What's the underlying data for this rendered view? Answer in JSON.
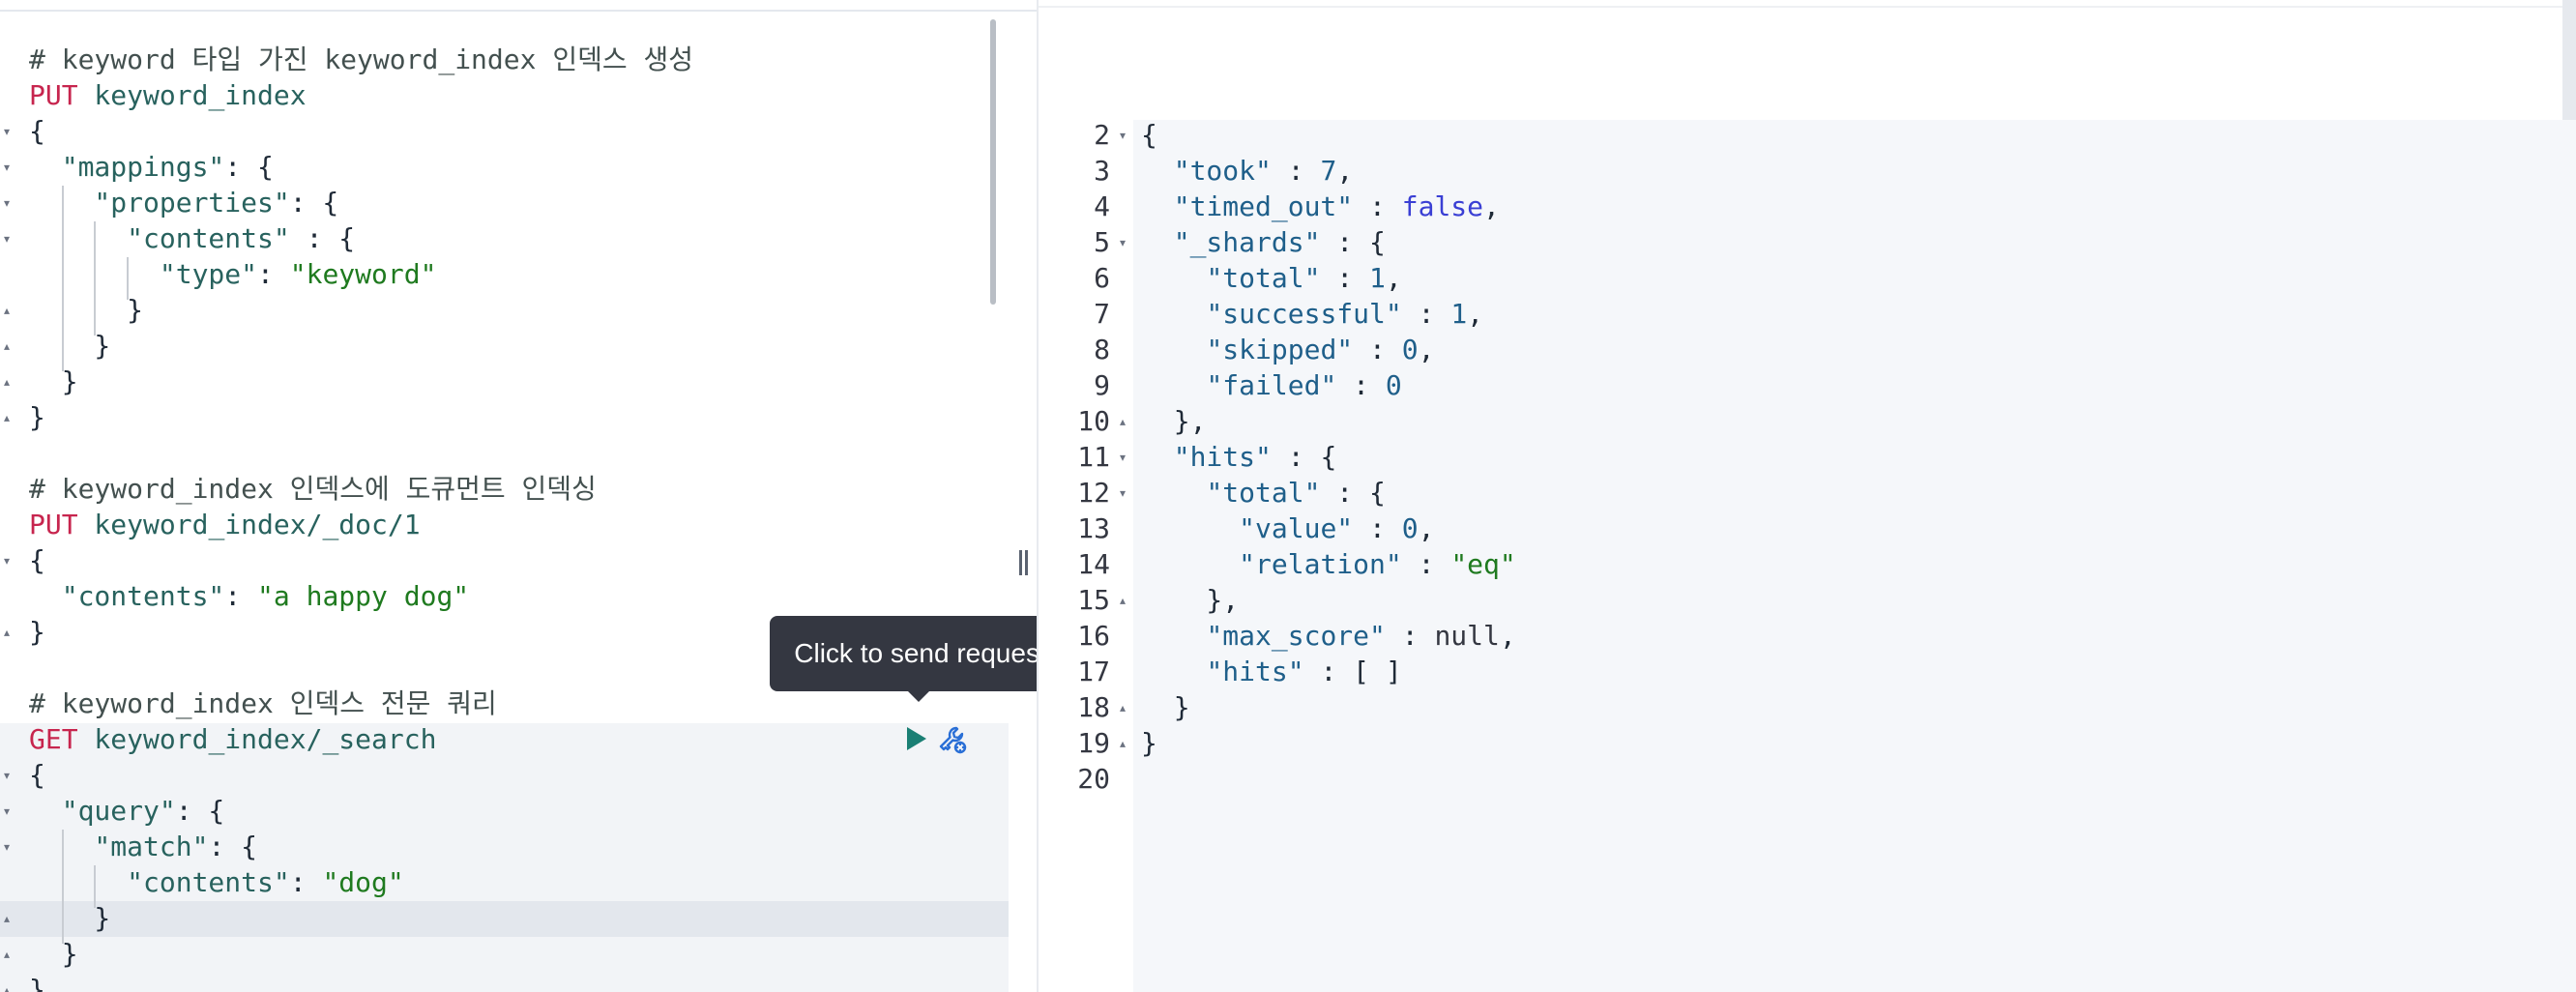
{
  "editor": {
    "lines": [
      {
        "text": "# keyword 타입 가진 keyword_index 인덱스 생성",
        "kind": "comment"
      },
      {
        "method": "PUT",
        "url": " keyword_index",
        "kind": "request"
      },
      {
        "text": "{",
        "kind": "punct"
      },
      {
        "key": "  \"mappings\"",
        "rest": ": {",
        "kind": "kv"
      },
      {
        "key": "    \"properties\"",
        "rest": ": {",
        "kind": "kv"
      },
      {
        "key": "      \"contents\"",
        "rest": " : {",
        "kind": "kv"
      },
      {
        "key": "        \"type\"",
        "rest": ": ",
        "str": "\"keyword\"",
        "kind": "kvs"
      },
      {
        "text": "      }",
        "kind": "punct"
      },
      {
        "text": "    }",
        "kind": "punct"
      },
      {
        "text": "  }",
        "kind": "punct"
      },
      {
        "text": "}",
        "kind": "punct"
      },
      {
        "text": "",
        "kind": "blank"
      },
      {
        "text": "# keyword_index 인덱스에 도큐먼트 인덱싱",
        "kind": "comment"
      },
      {
        "method": "PUT",
        "url": " keyword_index/_doc/1",
        "kind": "request"
      },
      {
        "text": "{",
        "kind": "punct"
      },
      {
        "key": "  \"contents\"",
        "rest": ": ",
        "str": "\"a happy dog\"",
        "kind": "kvs"
      },
      {
        "text": "}",
        "kind": "punct"
      },
      {
        "text": "",
        "kind": "blank"
      },
      {
        "text": "# keyword_index 인덱스 전문 쿼리",
        "kind": "comment"
      },
      {
        "method": "GET",
        "url": " keyword_index/_search",
        "kind": "request"
      },
      {
        "text": "{",
        "kind": "punct"
      },
      {
        "key": "  \"query\"",
        "rest": ": {",
        "kind": "kv"
      },
      {
        "key": "    \"match\"",
        "rest": ": {",
        "kind": "kv"
      },
      {
        "key": "      \"contents\"",
        "rest": ": ",
        "str": "\"dog\"",
        "kind": "kvs"
      },
      {
        "text": "    }",
        "kind": "punct"
      },
      {
        "text": "  }",
        "kind": "punct"
      },
      {
        "text": "}",
        "kind": "punct"
      }
    ]
  },
  "actions": {
    "send_icon": "play-icon",
    "settings_icon": "wrench-icon",
    "tooltip": "Click to send request"
  },
  "response": {
    "lines": [
      {
        "num": "2",
        "parts": [
          [
            "p",
            "{"
          ]
        ]
      },
      {
        "num": "3",
        "parts": [
          [
            "p",
            "  "
          ],
          [
            "k",
            "\"took\""
          ],
          [
            "p",
            " : "
          ],
          [
            "n",
            "7"
          ],
          [
            "p",
            ","
          ]
        ]
      },
      {
        "num": "4",
        "parts": [
          [
            "p",
            "  "
          ],
          [
            "k",
            "\"timed_out\""
          ],
          [
            "p",
            " : "
          ],
          [
            "b",
            "false"
          ],
          [
            "p",
            ","
          ]
        ]
      },
      {
        "num": "5",
        "parts": [
          [
            "p",
            "  "
          ],
          [
            "k",
            "\"_shards\""
          ],
          [
            "p",
            " : {"
          ]
        ]
      },
      {
        "num": "6",
        "parts": [
          [
            "p",
            "    "
          ],
          [
            "k",
            "\"total\""
          ],
          [
            "p",
            " : "
          ],
          [
            "n",
            "1"
          ],
          [
            "p",
            ","
          ]
        ]
      },
      {
        "num": "7",
        "parts": [
          [
            "p",
            "    "
          ],
          [
            "k",
            "\"successful\""
          ],
          [
            "p",
            " : "
          ],
          [
            "n",
            "1"
          ],
          [
            "p",
            ","
          ]
        ]
      },
      {
        "num": "8",
        "parts": [
          [
            "p",
            "    "
          ],
          [
            "k",
            "\"skipped\""
          ],
          [
            "p",
            " : "
          ],
          [
            "n",
            "0"
          ],
          [
            "p",
            ","
          ]
        ]
      },
      {
        "num": "9",
        "parts": [
          [
            "p",
            "    "
          ],
          [
            "k",
            "\"failed\""
          ],
          [
            "p",
            " : "
          ],
          [
            "n",
            "0"
          ]
        ]
      },
      {
        "num": "10",
        "parts": [
          [
            "p",
            "  },"
          ]
        ]
      },
      {
        "num": "11",
        "parts": [
          [
            "p",
            "  "
          ],
          [
            "k",
            "\"hits\""
          ],
          [
            "p",
            " : {"
          ]
        ]
      },
      {
        "num": "12",
        "parts": [
          [
            "p",
            "    "
          ],
          [
            "k",
            "\"total\""
          ],
          [
            "p",
            " : {"
          ]
        ]
      },
      {
        "num": "13",
        "parts": [
          [
            "p",
            "      "
          ],
          [
            "k",
            "\"value\""
          ],
          [
            "p",
            " : "
          ],
          [
            "n",
            "0"
          ],
          [
            "p",
            ","
          ]
        ]
      },
      {
        "num": "14",
        "parts": [
          [
            "p",
            "      "
          ],
          [
            "k",
            "\"relation\""
          ],
          [
            "p",
            " : "
          ],
          [
            "s",
            "\"eq\""
          ]
        ]
      },
      {
        "num": "15",
        "parts": [
          [
            "p",
            "    },"
          ]
        ]
      },
      {
        "num": "16",
        "parts": [
          [
            "p",
            "    "
          ],
          [
            "k",
            "\"max_score\""
          ],
          [
            "p",
            " : "
          ],
          [
            "x",
            "null"
          ],
          [
            "p",
            ","
          ]
        ]
      },
      {
        "num": "17",
        "parts": [
          [
            "p",
            "    "
          ],
          [
            "k",
            "\"hits\""
          ],
          [
            "p",
            " : [ ]"
          ]
        ]
      },
      {
        "num": "18",
        "parts": [
          [
            "p",
            "  }"
          ]
        ]
      },
      {
        "num": "19",
        "parts": [
          [
            "p",
            "}"
          ]
        ]
      },
      {
        "num": "20",
        "parts": []
      }
    ]
  }
}
